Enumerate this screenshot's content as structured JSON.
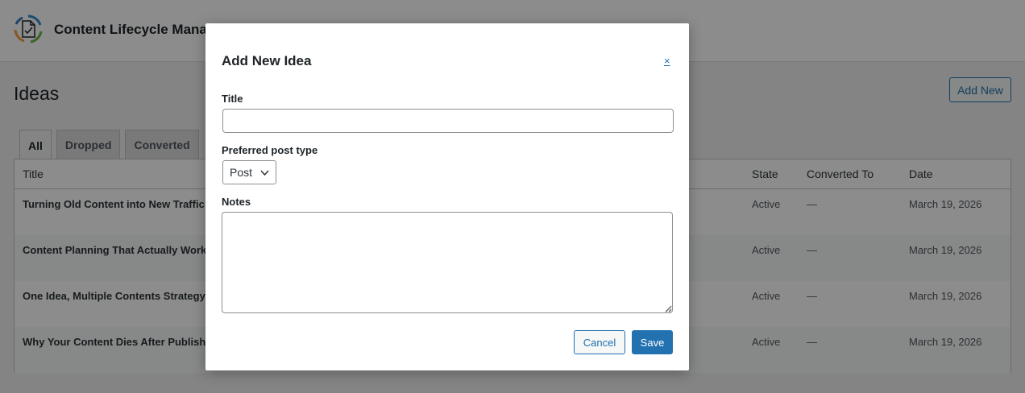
{
  "app": {
    "title": "Content Lifecycle Manager",
    "logo_icon": "document-cycle-icon"
  },
  "page": {
    "heading": "Ideas",
    "add_new_label": "Add New"
  },
  "tabs": [
    {
      "label": "All",
      "active": true
    },
    {
      "label": "Dropped",
      "active": false
    },
    {
      "label": "Converted",
      "active": false
    }
  ],
  "table": {
    "columns": {
      "title": "Title",
      "state": "State",
      "converted_to": "Converted To",
      "date": "Date"
    },
    "rows": [
      {
        "title": "Turning Old Content into New Traffic",
        "state": "Active",
        "converted_to": "—",
        "date": "March 19, 2026"
      },
      {
        "title": "Content Planning That Actually Works",
        "state": "Active",
        "converted_to": "—",
        "date": "March 19, 2026"
      },
      {
        "title": "One Idea, Multiple Contents Strategy",
        "state": "Active",
        "converted_to": "—",
        "date": "March 19, 2026"
      },
      {
        "title": "Why Your Content Dies After Publishing",
        "state": "Active",
        "converted_to": "—",
        "date": "March 19, 2026"
      }
    ]
  },
  "modal": {
    "title": "Add New Idea",
    "close_label": "×",
    "title_label": "Title",
    "title_value": "",
    "post_type_label": "Preferred post type",
    "post_type_value": "Post",
    "notes_label": "Notes",
    "notes_value": "",
    "cancel_label": "Cancel",
    "save_label": "Save"
  },
  "colors": {
    "accent": "#2271b1",
    "overlay": "rgba(0,0,0,0.45)"
  }
}
